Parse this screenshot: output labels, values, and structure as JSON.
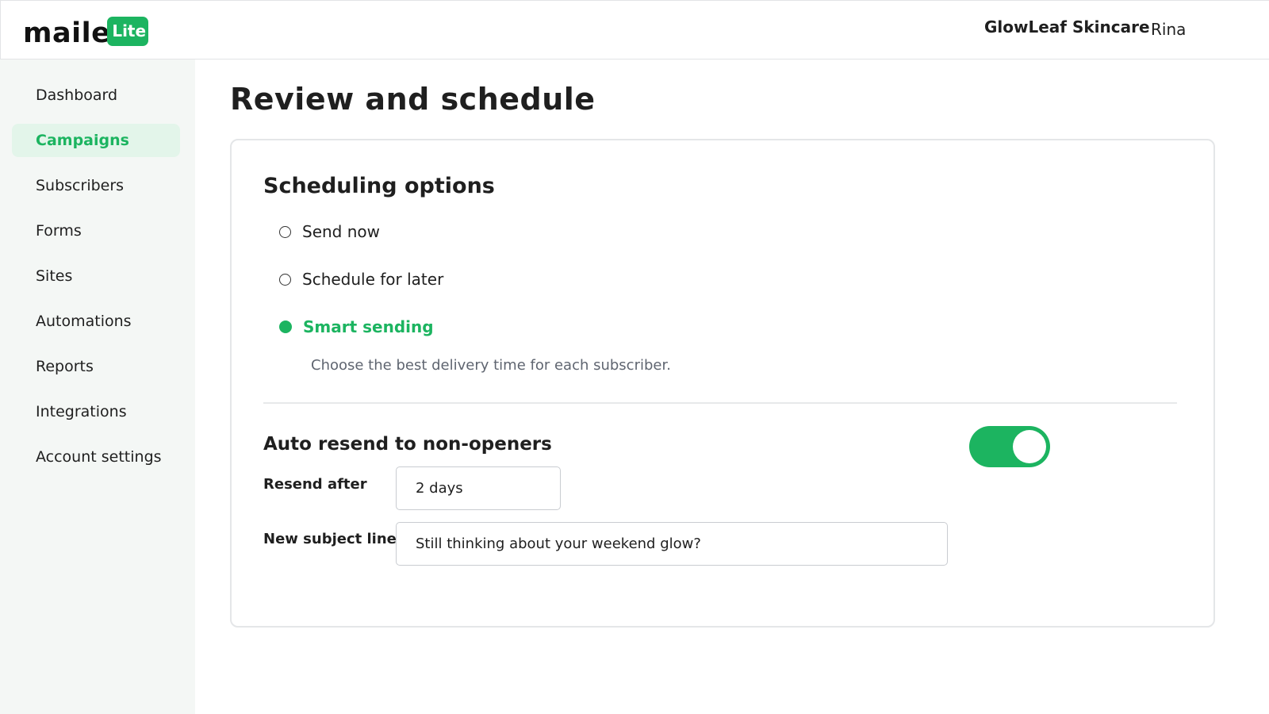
{
  "brand": {
    "logo_text": "maile",
    "badge": "Lite",
    "accent_color": "#1cb460"
  },
  "header": {
    "account_name": "GlowLeaf Skincare",
    "user_name": "Rina"
  },
  "sidebar": {
    "items": [
      {
        "label": "Dashboard",
        "active": false
      },
      {
        "label": "Campaigns",
        "active": true
      },
      {
        "label": "Subscribers",
        "active": false
      },
      {
        "label": "Forms",
        "active": false
      },
      {
        "label": "Sites",
        "active": false
      },
      {
        "label": "Automations",
        "active": false
      },
      {
        "label": "Reports",
        "active": false
      },
      {
        "label": "Integrations",
        "active": false
      },
      {
        "label": "Account settings",
        "active": false
      }
    ]
  },
  "main": {
    "page_title": "Review and schedule",
    "scheduling": {
      "title": "Scheduling options",
      "options": [
        {
          "label": "Send now",
          "selected": false
        },
        {
          "label": "Schedule for later",
          "selected": false
        },
        {
          "label": "Smart sending",
          "selected": true
        }
      ],
      "smart_help": "Choose the best delivery time for each subscriber."
    },
    "auto_resend": {
      "title": "Auto resend to non-openers",
      "enabled": true,
      "resend_after_label": "Resend after",
      "resend_after_value": "2 days",
      "subject_label": "New subject line",
      "subject_value": "Still thinking about your weekend glow?"
    }
  }
}
